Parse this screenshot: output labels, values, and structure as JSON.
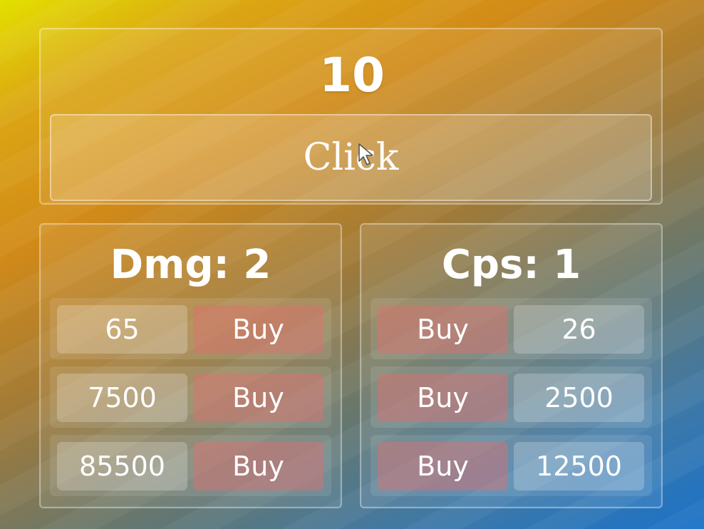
{
  "score": "10",
  "click_button": {
    "label": "Click"
  },
  "damage": {
    "title": "Dmg: 2",
    "upgrades": [
      {
        "cost": "65",
        "buy_label": "Buy"
      },
      {
        "cost": "7500",
        "buy_label": "Buy"
      },
      {
        "cost": "85500",
        "buy_label": "Buy"
      }
    ]
  },
  "cps": {
    "title": "Cps: 1",
    "upgrades": [
      {
        "cost": "26",
        "buy_label": "Buy"
      },
      {
        "cost": "2500",
        "buy_label": "Buy"
      },
      {
        "cost": "12500",
        "buy_label": "Buy"
      }
    ]
  },
  "icons": {
    "cursor": "mouse-cursor-icon"
  },
  "colors": {
    "buy_button": "#e06e6e",
    "text": "#ffffff",
    "background_top": "#e3e000",
    "background_bottom": "#1a72c9"
  }
}
